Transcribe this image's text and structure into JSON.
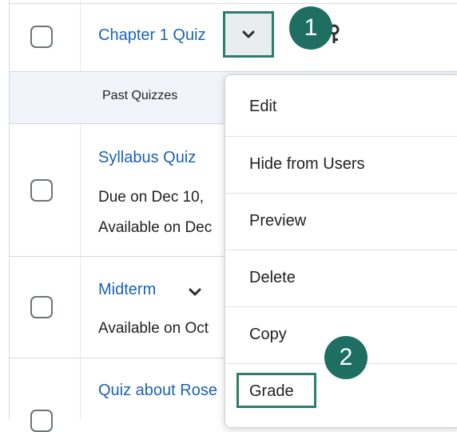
{
  "items": [
    {
      "title": "Chapter 1 Quiz"
    },
    {
      "title": "Syllabus Quiz",
      "line1": "Due on Dec 10,",
      "line2": "Available on Dec"
    },
    {
      "title": "Midterm",
      "line1": "Available on Oct"
    },
    {
      "title": "Quiz about Rose"
    }
  ],
  "section": {
    "label": "Past Quizzes"
  },
  "menu": {
    "items": [
      {
        "label": "Edit"
      },
      {
        "label": "Hide from Users"
      },
      {
        "label": "Preview"
      },
      {
        "label": "Delete"
      },
      {
        "label": "Copy"
      },
      {
        "label": "Grade"
      }
    ]
  },
  "callouts": {
    "one": "1",
    "two": "2"
  },
  "colors": {
    "link": "#1b62b3",
    "accent": "#1e6f62",
    "highlight_border": "#2e7d6e"
  }
}
